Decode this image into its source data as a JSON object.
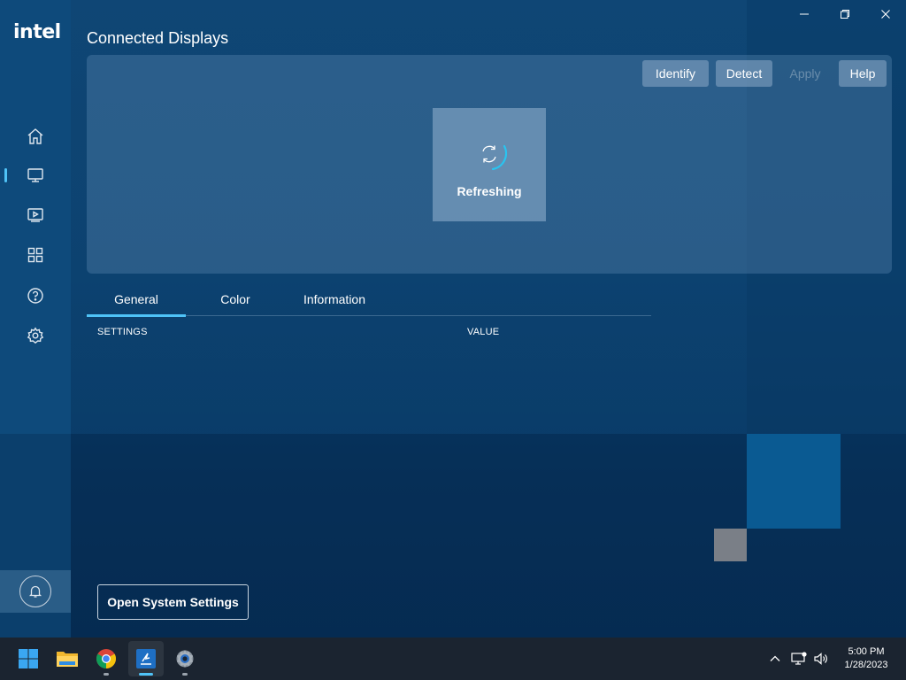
{
  "app": {
    "logo_text": "intel",
    "page_title": "Connected Displays"
  },
  "sidebar": {
    "items": [
      {
        "name": "home",
        "icon": "home-icon"
      },
      {
        "name": "display",
        "icon": "monitor-icon",
        "active": true
      },
      {
        "name": "video",
        "icon": "video-icon"
      },
      {
        "name": "apps",
        "icon": "grid-icon"
      },
      {
        "name": "help",
        "icon": "help-icon"
      },
      {
        "name": "settings",
        "icon": "gear-icon"
      }
    ],
    "notification_icon": "bell-icon"
  },
  "toolbar": {
    "identify_label": "Identify",
    "detect_label": "Detect",
    "apply_label": "Apply",
    "help_label": "Help"
  },
  "status": {
    "refreshing_label": "Refreshing"
  },
  "tabs": [
    {
      "label": "General",
      "active": true
    },
    {
      "label": "Color",
      "active": false
    },
    {
      "label": "Information",
      "active": false
    }
  ],
  "table": {
    "headers": [
      "SETTINGS",
      "VALUE"
    ]
  },
  "footer": {
    "system_settings_label": "Open System Settings"
  },
  "taskbar": {
    "apps": [
      {
        "name": "start",
        "icon": "windows-start-icon"
      },
      {
        "name": "file-explorer",
        "icon": "folder-icon"
      },
      {
        "name": "chrome",
        "icon": "chrome-icon"
      },
      {
        "name": "intel-graphics",
        "icon": "intel-graphics-icon",
        "active": true
      },
      {
        "name": "settings",
        "icon": "settings-gear-icon"
      }
    ],
    "clock": {
      "time": "5:00 PM",
      "date": "1/28/2023"
    }
  },
  "colors": {
    "accent": "#4fc3f7",
    "background": "#093a66",
    "taskbar": "#1b2430"
  }
}
